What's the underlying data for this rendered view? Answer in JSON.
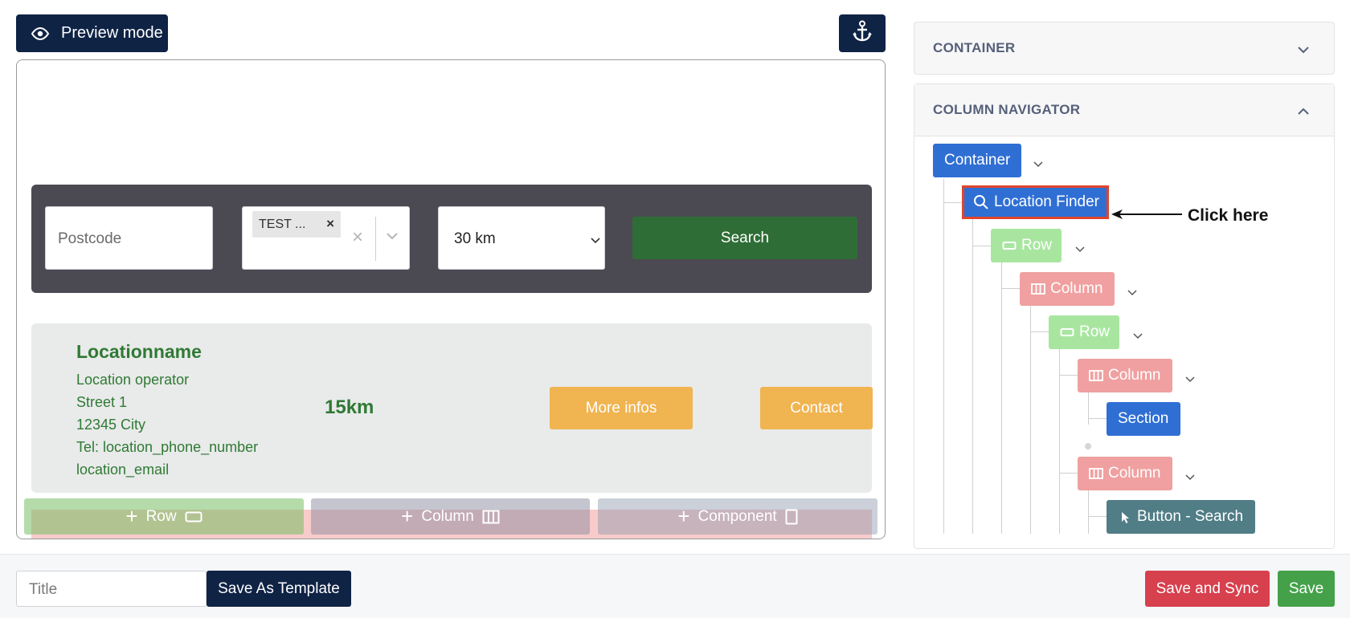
{
  "toolbar": {
    "preview_label": "Preview mode",
    "preview_icon": "eye-icon",
    "anchor_icon": "anchor-icon"
  },
  "canvas": {
    "search": {
      "postcode_placeholder": "Postcode",
      "tag_label": "TEST ...",
      "tag_remove": "×",
      "clear_symbol": "×",
      "distance_value": "30 km",
      "search_label": "Search"
    },
    "result": {
      "name": "Locationname",
      "lines": [
        "Location operator",
        "Street 1",
        "12345 City",
        "Tel: location_phone_number",
        "location_email"
      ],
      "distance": "15km",
      "more_label": "More infos",
      "contact_label": "Contact"
    },
    "add": {
      "row_label": "Row",
      "column_label": "Column",
      "component_label": "Component"
    }
  },
  "panel": {
    "container_title": "CONTAINER",
    "navigator_title": "COLUMN NAVIGATOR",
    "tree": {
      "container": "Container",
      "location_finder": "Location Finder",
      "row1": "Row",
      "column1": "Column",
      "row2": "Row",
      "column2": "Column",
      "section": "Section",
      "column3": "Column",
      "button_search": "Button - Search"
    }
  },
  "annotation": {
    "click_here": "Click here"
  },
  "footer": {
    "title_placeholder": "Title",
    "save_template_label": "Save As Template",
    "save_sync_label": "Save and Sync",
    "save_label": "Save"
  },
  "colors": {
    "navy": "#0f2345",
    "green_dark": "#2f6d36",
    "orange": "#f0b450",
    "blue": "#2f6fd4",
    "red": "#d7404d",
    "save_green": "#44a149"
  }
}
